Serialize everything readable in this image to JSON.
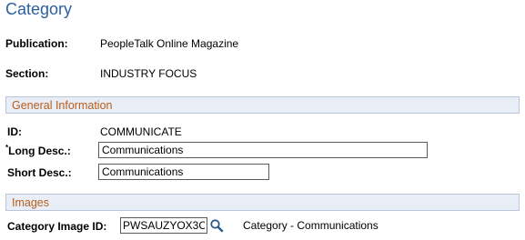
{
  "page": {
    "title": "Category"
  },
  "header": {
    "publication_label": "Publication:",
    "publication_value": "PeopleTalk Online Magazine",
    "section_label": "Section:",
    "section_value": "INDUSTRY FOCUS"
  },
  "general_information": {
    "title": "General Information",
    "id_label": "ID:",
    "id_value": "COMMUNICATE",
    "required_marker": "*",
    "long_desc_label": "Long Desc.:",
    "long_desc_value": "Communications",
    "short_desc_label": "Short Desc.:",
    "short_desc_value": "Communications"
  },
  "images": {
    "title": "Images",
    "category_image_id_label": "Category Image ID:",
    "category_image_id_value": "PWSAUZYOX3C",
    "lookup_icon": "magnifier-icon",
    "category_image_description": "Category - Communications"
  },
  "colors": {
    "title": "#2c5f9e",
    "section_title": "#b85c1a",
    "section_background": "#e9eef6",
    "section_border": "#b7c6da"
  }
}
